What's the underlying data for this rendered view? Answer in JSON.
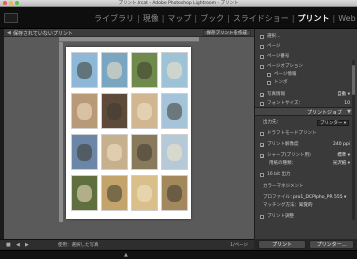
{
  "window": {
    "title": "プリント.lrcat - Adobe Photoshop Lightroom - プリント"
  },
  "modules": {
    "items": [
      {
        "label": "ライブラリ",
        "active": false
      },
      {
        "label": "現像",
        "active": false
      },
      {
        "label": "マップ",
        "active": false
      },
      {
        "label": "ブック",
        "active": false
      },
      {
        "label": "スライドショー",
        "active": false
      },
      {
        "label": "プリント",
        "active": true
      },
      {
        "label": "Web",
        "active": false
      }
    ],
    "separator": "|"
  },
  "work_header": {
    "chevron": "◀",
    "unsaved_label": "保存されていないプリント",
    "save_button_label": "保存プリントを作成"
  },
  "page": {
    "rows": 4,
    "cols": 4,
    "photo_colors": [
      [
        "#8fb8d8",
        "#7aa6c2",
        "#6f8a4a",
        "#9fc3d6"
      ],
      [
        "#b89a78",
        "#5d4a3a",
        "#d0b792",
        "#a5c4d9"
      ],
      [
        "#6b86a6",
        "#c7b08e",
        "#8a7a5c",
        "#b6c9d6"
      ],
      [
        "#5f6f3d",
        "#c4a46b",
        "#d9c08a",
        "#a3885e"
      ]
    ]
  },
  "bottom_toolbar": {
    "icons": [
      "stop-icon",
      "prev-icon",
      "next-icon"
    ],
    "use_label": "使用：選択した写真",
    "page_count": "1/ページ"
  },
  "right_panel": {
    "rows": [
      {
        "label": "選択…",
        "checkbox": false,
        "value": ""
      },
      {
        "label": "ページ",
        "checkbox": false,
        "value": ""
      },
      {
        "label": "ページ番号",
        "checkbox": false,
        "value": ""
      },
      {
        "label": "ページオプション",
        "checkbox": false,
        "value": ""
      },
      {
        "label": "ページ情報",
        "checkbox": false,
        "value": ""
      },
      {
        "label": "トンボ",
        "checkbox": false,
        "value": ""
      },
      {
        "label": "写真情報",
        "checkbox": true,
        "value": "自動 ▾"
      },
      {
        "label": "フォントサイズ：",
        "checkbox": false,
        "value": "10"
      }
    ],
    "print_job": {
      "section_label": "プリントジョブ",
      "print_to_label": "出力先：",
      "print_to_value": "プリンター ▾",
      "draft_label": "ドラフトモードプリント",
      "resolution_label": "プリント解像度",
      "resolution_value": "240 ppi",
      "sharpen_label": "シャープ(プリント用)",
      "sharpen_value": "標準 ▾",
      "media_label": "用紙の種類：",
      "media_value": "光沢紙 ▾",
      "depth_label": "16 bit 出力",
      "color_mgmt_label": "カラーマネジメント",
      "profile_label": "プロファイル：",
      "profile_value": "pro1_DCPlpho_PR 555 ▾",
      "intent_label": "マッチング方法：",
      "intent_value": "知覚的",
      "adjust_label": "プリント調整"
    }
  },
  "buttons": {
    "print": "プリント",
    "printer": "プリンター..."
  }
}
